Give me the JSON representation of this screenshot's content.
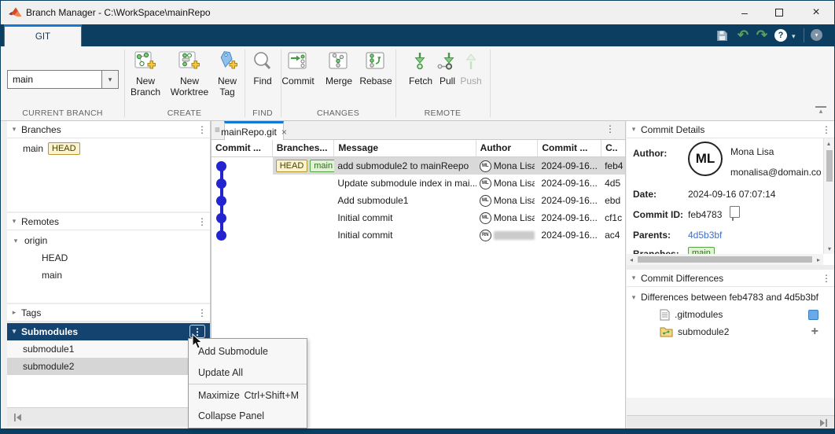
{
  "colors": {
    "navy": "#0b3e61",
    "accent_blue": "#1379d4",
    "graph_blue": "#2424cf",
    "selected_row": "#d9d9d9",
    "head_badge_border": "#b5992c",
    "main_badge_border": "#57a345",
    "link_blue": "#3f6fc4",
    "modified_square_blue": "#6aa9e9"
  },
  "icons": {
    "kebab": "⋮",
    "collapse_down": "▾",
    "collapse_right": "▸",
    "grip": "≡",
    "close": "×",
    "minimize": "–",
    "undo": "↶",
    "redo": "↷",
    "help": "?",
    "caret_down": "▾",
    "scroll_up": "▴",
    "scroll_down": "▾",
    "scroll_left": "◂",
    "scroll_right": "▸",
    "ribbon_collapse": "▴"
  },
  "titlebar": {
    "title": "Branch Manager - C:\\WorkSpace\\mainRepo"
  },
  "ribbon": {
    "tab_label": "GIT"
  },
  "toolbar": {
    "current_branch": {
      "value": "main",
      "section": "CURRENT BRANCH"
    },
    "create": {
      "section": "CREATE",
      "new_branch": [
        "New",
        "Branch"
      ],
      "new_worktree": [
        "New",
        "Worktree"
      ],
      "new_tag": [
        "New",
        "Tag"
      ]
    },
    "find": {
      "section": "FIND",
      "find": "Find"
    },
    "changes": {
      "section": "CHANGES",
      "commit": "Commit",
      "merge": "Merge",
      "rebase": "Rebase"
    },
    "remote": {
      "section": "REMOTE",
      "fetch": "Fetch",
      "pull": "Pull",
      "push": "Push"
    }
  },
  "sidebar": {
    "branches": {
      "title": "Branches",
      "item": "main",
      "badge": "HEAD"
    },
    "remotes": {
      "title": "Remotes",
      "root": "origin",
      "children": [
        "HEAD",
        "main"
      ]
    },
    "tags": {
      "title": "Tags"
    },
    "submodules": {
      "title": "Submodules",
      "items": [
        "submodule1",
        "submodule2"
      ]
    }
  },
  "editor": {
    "tab": "mainRepo.git",
    "columns": [
      "Commit ...",
      "Branches...",
      "Message",
      "Author",
      "Commit ...",
      "C.."
    ],
    "rows": [
      {
        "head_badge": "HEAD",
        "main_badge": "main",
        "message": "add submodule2 to mainReepo",
        "initials": "ML",
        "author": "Mona Lisa",
        "date": "2024-09-16...",
        "sha": "feb4"
      },
      {
        "message": "Update submodule index in mai...",
        "initials": "ML",
        "author": "Mona Lisa",
        "date": "2024-09-16...",
        "sha": "4d5"
      },
      {
        "message": "Add submodule1",
        "initials": "ML",
        "author": "Mona Lisa",
        "date": "2024-09-16...",
        "sha": "ebd"
      },
      {
        "message": "Initial commit",
        "initials": "ML",
        "author": "Mona Lisa",
        "date": "2024-09-16...",
        "sha": "cf1c"
      },
      {
        "message": "Initial commit",
        "initials": "RN",
        "author": "",
        "date": "2024-09-16...",
        "sha": "ac4"
      }
    ]
  },
  "commit_details": {
    "title": "Commit Details",
    "author_label": "Author:",
    "initials": "ML",
    "author_name": "Mona Lisa",
    "author_email": "monalisa@domain.com",
    "date_label": "Date:",
    "date_value": "2024-09-16 07:07:14",
    "commit_id_label": "Commit ID:",
    "commit_id_value": "feb4783",
    "parents_label": "Parents:",
    "parents_value": "4d5b3bf",
    "branches_label": "Branches:",
    "branch_badge": "main"
  },
  "commit_differences": {
    "title": "Commit Differences",
    "group_label": "Differences between feb4783 and 4d5b3bf",
    "file1": ".gitmodules",
    "file2": "submodule2",
    "file2_status": "+"
  },
  "context_menu": {
    "add_submodule": "Add Submodule",
    "update_all": "Update All",
    "maximize": "Maximize",
    "maximize_shortcut": "Ctrl+Shift+M",
    "collapse_panel": "Collapse Panel"
  }
}
